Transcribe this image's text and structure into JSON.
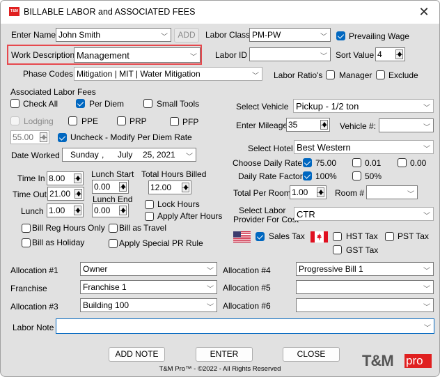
{
  "window": {
    "title": "BILLABLE LABOR and ASSOCIATED FEES",
    "app_icon_text": "T&M",
    "close_glyph": "✕"
  },
  "header": {
    "enter_name": {
      "label": "Enter Name",
      "value": "John Smith"
    },
    "add_button": "ADD",
    "labor_class": {
      "label": "Labor Class",
      "value": "PM-PW"
    },
    "prevailing_wage": {
      "label": "Prevailing Wage",
      "checked": true
    },
    "work_description": {
      "label": "Work Description",
      "value": "Management"
    },
    "labor_id": {
      "label": "Labor ID",
      "value": ""
    },
    "sort_value": {
      "label": "Sort Value",
      "value": "4"
    },
    "phase_codes": {
      "label": "Phase Codes",
      "value": "Mitigation | MIT | Water Mitigation"
    },
    "labor_ratios": {
      "label": "Labor Ratio's"
    },
    "manager": {
      "label": "Manager",
      "checked": false
    },
    "exclude": {
      "label": "Exclude",
      "checked": false
    }
  },
  "fees": {
    "section_label": "Associated Labor Fees",
    "check_all": {
      "label": "Check All",
      "checked": false
    },
    "per_diem": {
      "label": "Per Diem",
      "checked": true
    },
    "small_tools": {
      "label": "Small Tools",
      "checked": false
    },
    "lodging": {
      "label": "Lodging",
      "checked": false,
      "disabled": true
    },
    "ppe": {
      "label": "PPE",
      "checked": false
    },
    "prp": {
      "label": "PRP",
      "checked": false
    },
    "pfp": {
      "label": "PFP",
      "checked": false
    },
    "per_diem_rate": "55.00",
    "modify_per_diem": {
      "label": "Uncheck - Modify Per Diem Rate",
      "checked": true
    },
    "date_worked": {
      "label": "Date Worked",
      "day": "Sunday",
      "sep": ",",
      "month": "July",
      "date": "25, 2021"
    }
  },
  "hours": {
    "time_in": {
      "label": "Time In",
      "value": "8.00"
    },
    "time_out": {
      "label": "Time Out",
      "value": "21.00"
    },
    "lunch": {
      "label": "Lunch",
      "value": "1.00"
    },
    "lunch_start": {
      "label": "Lunch Start",
      "value": "0.00"
    },
    "lunch_end": {
      "label": "Lunch End",
      "value": "0.00"
    },
    "total_hours_billed": {
      "label": "Total Hours Billed",
      "value": "12.00"
    },
    "lock_hours": {
      "label": "Lock Hours",
      "checked": false
    },
    "apply_after_hours": {
      "label": "Apply After Hours",
      "checked": false
    },
    "bill_reg_hours_only": {
      "label": "Bill Reg Hours Only",
      "checked": false
    },
    "bill_as_travel": {
      "label": "Bill as Travel",
      "checked": false
    },
    "bill_as_holiday": {
      "label": "Bill as Holiday",
      "checked": false
    },
    "apply_special_pr_rule": {
      "label": "Apply Special PR Rule",
      "checked": false
    }
  },
  "travel": {
    "select_vehicle": {
      "label": "Select Vehicle",
      "value": "Pickup - 1/2 ton"
    },
    "enter_mileage": {
      "label": "Enter Mileage",
      "value": "35"
    },
    "vehicle_number": {
      "label": "Vehicle #:",
      "value": ""
    },
    "select_hotel": {
      "label": "Select Hotel",
      "value": "Best Western"
    },
    "choose_daily_rate": {
      "label": "Choose Daily Rate",
      "options": [
        {
          "label": "75.00",
          "checked": true
        },
        {
          "label": "0.01",
          "checked": false
        },
        {
          "label": "0.00",
          "checked": false
        }
      ]
    },
    "daily_rate_factor": {
      "label": "Daily Rate Factor",
      "options": [
        {
          "label": "100%",
          "checked": true
        },
        {
          "label": "50%",
          "checked": false
        }
      ]
    },
    "total_per_room": {
      "label": "Total Per Room",
      "value": "1.00"
    },
    "room_number": {
      "label": "Room #",
      "value": ""
    },
    "labor_provider": {
      "label_line1": "Select Labor",
      "label_line2": "Provider For Cost",
      "value": "CTR"
    }
  },
  "taxes": {
    "us_flag": "us-flag",
    "ca_flag": "canada-flag",
    "sales_tax": {
      "label": "Sales Tax",
      "checked": true
    },
    "hst_tax": {
      "label": "HST Tax",
      "checked": false
    },
    "pst_tax": {
      "label": "PST Tax",
      "checked": false
    },
    "gst_tax": {
      "label": "GST Tax",
      "checked": false
    }
  },
  "allocations": {
    "allocation_1": {
      "label": "Allocation #1",
      "value": "Owner"
    },
    "franchise": {
      "label": "Franchise",
      "value": "Franchise 1"
    },
    "allocation_3": {
      "label": "Allocation #3",
      "value": "Building 100"
    },
    "allocation_4": {
      "label": "Allocation #4",
      "value": "Progressive Bill 1"
    },
    "allocation_5": {
      "label": "Allocation #5",
      "value": ""
    },
    "allocation_6": {
      "label": "Allocation #6",
      "value": ""
    }
  },
  "labor_note": {
    "label": "Labor Note",
    "value": ""
  },
  "footer": {
    "add_note": "ADD NOTE",
    "enter": "ENTER",
    "close": "CLOSE",
    "copyright": "T&M Pro™ - ©2022 - All Rights Reserved",
    "logo_text": "T&M",
    "logo_pro": "pro"
  },
  "colors": {
    "accent": "#0067c0",
    "highlight": "#e6484d",
    "brand_red": "#e02020"
  }
}
